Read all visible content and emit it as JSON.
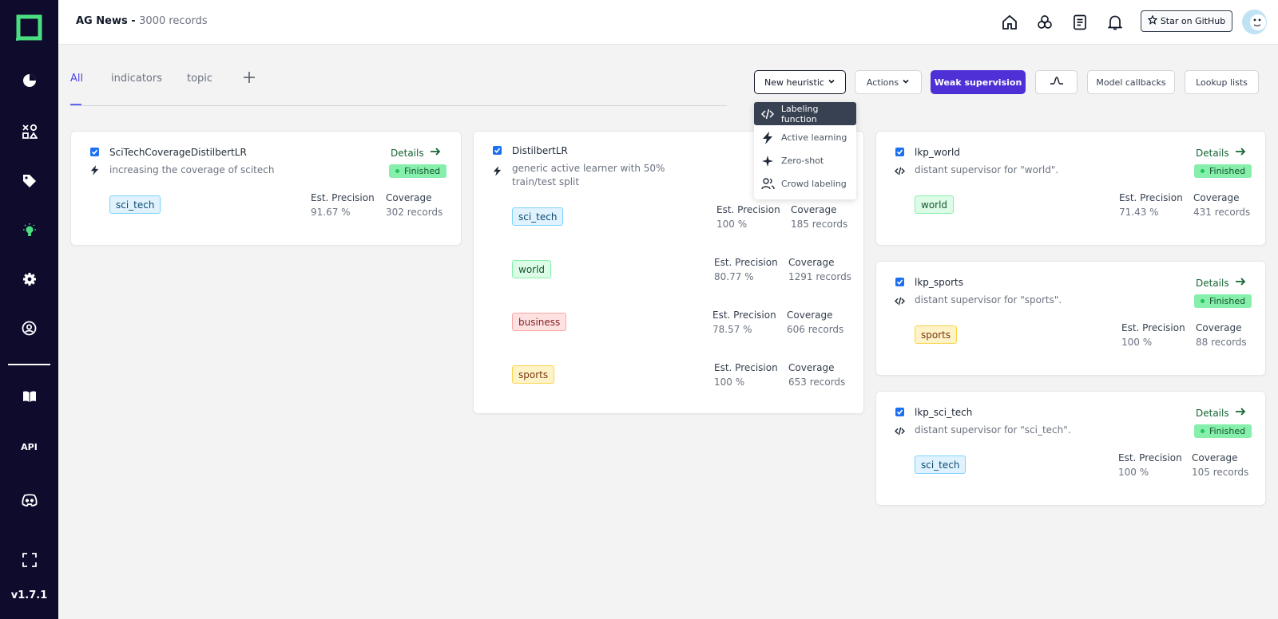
{
  "app": {
    "version": "v1.7.1",
    "project_title": "AG News",
    "project_sep": " - ",
    "project_records": "3000 records"
  },
  "sidebar": {
    "items": [
      {
        "icon": "overview-pie-icon"
      },
      {
        "icon": "data-browser-icon"
      },
      {
        "icon": "labeling-tag-icon"
      },
      {
        "icon": "heuristics-bulb-icon"
      },
      {
        "icon": "settings-gear-icon"
      },
      {
        "icon": "admin-user-icon"
      }
    ],
    "bottom": [
      {
        "icon": "docs-book-icon"
      },
      {
        "label": "API"
      },
      {
        "icon": "discord-icon"
      },
      {
        "icon": "fullscreen-icon"
      }
    ]
  },
  "header": {
    "github_label": "Star on GitHub"
  },
  "tabs": [
    {
      "label": "All",
      "active": true
    },
    {
      "label": "indicators",
      "active": false
    },
    {
      "label": "topic",
      "active": false
    }
  ],
  "toolbar": {
    "new_heuristic": "New heuristic",
    "actions": "Actions",
    "weak_supervision": "Weak supervision",
    "model_callbacks": "Model callbacks",
    "lookup_lists": "Lookup lists"
  },
  "dropdown": {
    "items": [
      {
        "label": "Labeling function",
        "icon": "code-icon",
        "selected": true
      },
      {
        "label": "Active learning",
        "icon": "lightning-icon",
        "selected": false
      },
      {
        "label": "Zero-shot",
        "icon": "sparkle-icon",
        "selected": false
      },
      {
        "label": "Crowd labeling",
        "icon": "users-icon",
        "selected": false
      }
    ]
  },
  "common": {
    "details": "Details",
    "finished": "Finished",
    "est_precision": "Est. Precision",
    "coverage": "Coverage"
  },
  "cards": [
    {
      "name": "SciTechCoverageDistilbertLR",
      "type_icon": "lightning-icon",
      "description": "increasing the coverage of scitech",
      "status": "Finished",
      "rows": [
        {
          "label": "sci_tech",
          "precision": "91.67 %",
          "coverage": "302 records"
        }
      ]
    },
    {
      "name": "DistilbertLR",
      "type_icon": "lightning-icon",
      "description_line1": "generic active learner with 50%",
      "description_line2": "train/test split",
      "rows": [
        {
          "label": "sci_tech",
          "precision": "100 %",
          "coverage": "185 records"
        },
        {
          "label": "world",
          "precision": "80.77 %",
          "coverage": "1291 records"
        },
        {
          "label": "business",
          "precision": "78.57 %",
          "coverage": "606 records"
        },
        {
          "label": "sports",
          "precision": "100 %",
          "coverage": "653 records"
        }
      ]
    },
    {
      "name": "lkp_world",
      "type_icon": "code-icon",
      "description": "distant supervisor for \"world\".",
      "status": "Finished",
      "rows": [
        {
          "label": "world",
          "precision": "71.43 %",
          "coverage": "431 records"
        }
      ]
    },
    {
      "name": "lkp_sports",
      "type_icon": "code-icon",
      "description": "distant supervisor for \"sports\".",
      "status": "Finished",
      "rows": [
        {
          "label": "sports",
          "precision": "100 %",
          "coverage": "88 records"
        }
      ]
    },
    {
      "name": "lkp_sci_tech",
      "type_icon": "code-icon",
      "description": "distant supervisor for \"sci_tech\".",
      "status": "Finished",
      "rows": [
        {
          "label": "sci_tech",
          "precision": "100 %",
          "coverage": "105 records"
        }
      ]
    }
  ],
  "colors": {
    "sidebar_bg": "#0e0b2d",
    "accent": "#4f2fd6",
    "active_nav": "#4ade80",
    "finished_badge": "#86efac"
  }
}
